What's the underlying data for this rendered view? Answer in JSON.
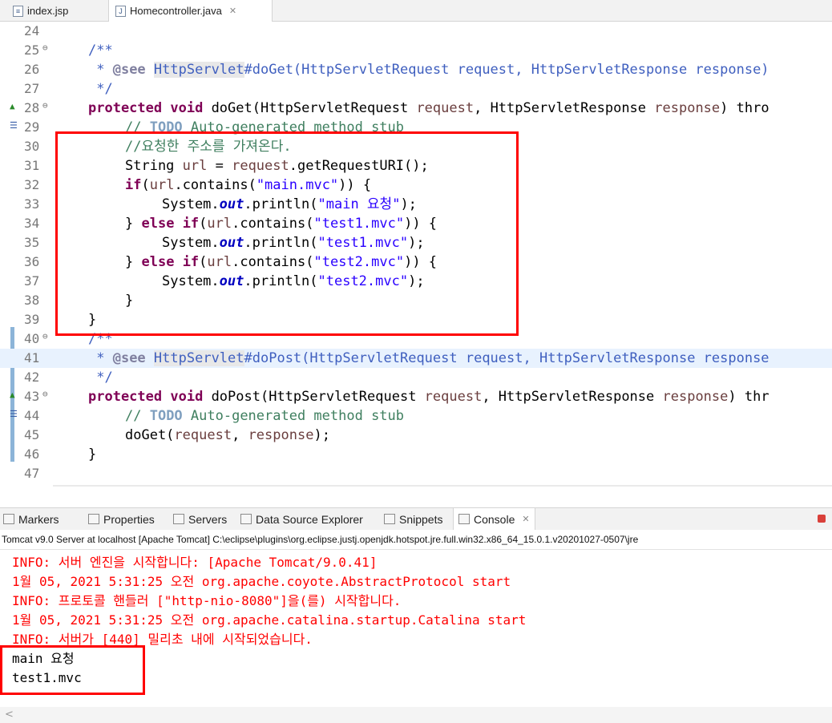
{
  "editor_tabs": [
    {
      "label": "index.jsp",
      "icon": "jsp-file-icon"
    },
    {
      "label": "Homecontroller.java",
      "icon": "java-file-icon",
      "active": true
    }
  ],
  "code_lines": [
    {
      "n": "24"
    },
    {
      "n": "25"
    },
    {
      "n": "26"
    },
    {
      "n": "27"
    },
    {
      "n": "28"
    },
    {
      "n": "29"
    },
    {
      "n": "30"
    },
    {
      "n": "31"
    },
    {
      "n": "32"
    },
    {
      "n": "33"
    },
    {
      "n": "34"
    },
    {
      "n": "35"
    },
    {
      "n": "36"
    },
    {
      "n": "37"
    },
    {
      "n": "38"
    },
    {
      "n": "39"
    },
    {
      "n": "40"
    },
    {
      "n": "41"
    },
    {
      "n": "42"
    },
    {
      "n": "43"
    },
    {
      "n": "44"
    },
    {
      "n": "45"
    },
    {
      "n": "46"
    },
    {
      "n": "47"
    }
  ],
  "code": {
    "l25": "/**",
    "l26_pre": " * ",
    "l26_tag": "@see",
    "l26_link": "HttpServlet",
    "l26_rest": "#doGet(HttpServletRequest request, HttpServletResponse response)",
    "l27": " */",
    "kw_protected": "protected",
    "kw_void": "void",
    "l28_name": " doGet(HttpServletRequest ",
    "p_request": "request",
    "l28_mid": ", HttpServletResponse ",
    "p_response": "response",
    "l28_end": ") thro",
    "l29_cm": "// ",
    "l29_todo": "TODO",
    "l29_rest": " Auto-generated method stub",
    "l30": "//요청한 주소를 가져온다.",
    "l31_a": "String ",
    "l31_var": "url",
    "l31_b": " = ",
    "l31_req": "request",
    "l31_c": ".getRequestURI();",
    "kw_if": "if",
    "l32_a": "(",
    "l32_var": "url",
    "l32_b": ".contains(",
    "s_main": "\"main.mvc\"",
    "l32_c": ")) {",
    "sys": "System.",
    "out": "out",
    "println": ".println(",
    "s_main_req": "\"main 요청\"",
    "close_stmt": ");",
    "else_open": "} ",
    "kw_else": "else",
    "s_test1": "\"test1.mvc\"",
    "s_test2": "\"test2.mvc\"",
    "brace": "}",
    "l41_link": "HttpServlet",
    "l41_rest": "#doPost(HttpServletRequest request, HttpServletResponse response",
    "l43_name": " doPost(HttpServletRequest ",
    "l43_end": ") thr",
    "l45_a": "doGet(",
    "l45_b": ", ",
    "l45_c": ");"
  },
  "view_tabs": [
    {
      "label": "Markers",
      "icon": "markers-icon"
    },
    {
      "label": "Properties",
      "icon": "properties-icon"
    },
    {
      "label": "Servers",
      "icon": "servers-icon"
    },
    {
      "label": "Data Source Explorer",
      "icon": "data-source-icon"
    },
    {
      "label": "Snippets",
      "icon": "snippets-icon"
    },
    {
      "label": "Console",
      "icon": "console-icon",
      "active": true
    }
  ],
  "console": {
    "header": "Tomcat v9.0 Server at localhost [Apache Tomcat] C:\\eclipse\\plugins\\org.eclipse.justj.openjdk.hotspot.jre.full.win32.x86_64_15.0.1.v20201027-0507\\jre",
    "lines": [
      {
        "text": "INFO: 서버 엔진을 시작합니다: [Apache Tomcat/9.0.41]",
        "type": "err"
      },
      {
        "text": "1월 05, 2021 5:31:25 오전 org.apache.coyote.AbstractProtocol start",
        "type": "err"
      },
      {
        "text": "INFO: 프로토콜 핸들러 [\"http-nio-8080\"]을(를) 시작합니다.",
        "type": "err"
      },
      {
        "text": "1월 05, 2021 5:31:25 오전 org.apache.catalina.startup.Catalina start",
        "type": "err"
      },
      {
        "text": "INFO: 서버가 [440] 밀리초 내에 시작되었습니다.",
        "type": "err"
      },
      {
        "text": "main 요청",
        "type": "out"
      },
      {
        "text": "test1.mvc",
        "type": "out"
      }
    ]
  },
  "colors": {
    "keyword": "#7f0055",
    "comment": "#3f7f5f",
    "string": "#2a00ff",
    "console_error": "#ff0000",
    "highlight_box": "#ff0000"
  }
}
